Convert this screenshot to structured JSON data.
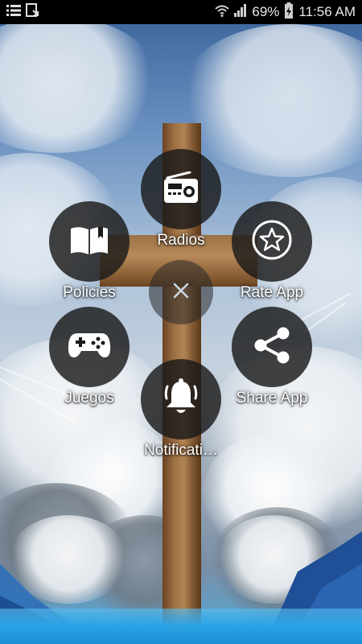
{
  "status_bar": {
    "battery": "69%",
    "time": "11:56 AM",
    "icons": [
      "list-notification-icon",
      "download-notification-icon",
      "wifi-icon",
      "signal-icon",
      "battery-charging-icon"
    ]
  },
  "menu": {
    "close_icon": "close-icon",
    "items": [
      {
        "label": "Radios",
        "icon": "radio-icon"
      },
      {
        "label": "Policies",
        "icon": "book-icon"
      },
      {
        "label": "Rate App",
        "icon": "star-icon"
      },
      {
        "label": "Juegos",
        "icon": "gamepad-icon"
      },
      {
        "label": "Share App",
        "icon": "share-icon"
      },
      {
        "label": "Notificati…",
        "icon": "bell-icon"
      }
    ]
  }
}
